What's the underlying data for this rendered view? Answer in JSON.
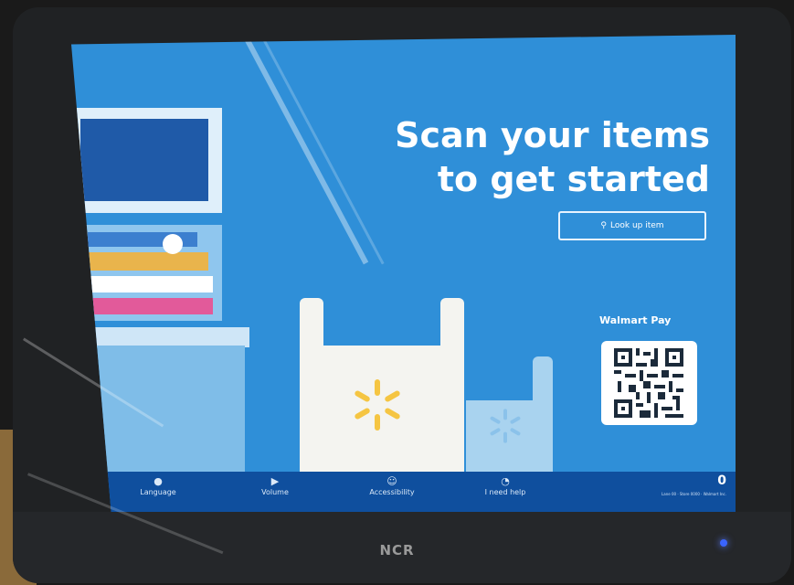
{
  "screen": {
    "headline_line1": "Scan your items",
    "headline_line2": "to get started",
    "lookup_button": "Look up item",
    "pay_label": "Walmart Pay",
    "qr_icon": "qr-code"
  },
  "navbar": {
    "items": [
      {
        "label": "Language",
        "icon": "globe-icon"
      },
      {
        "label": "Volume",
        "icon": "speaker-icon"
      },
      {
        "label": "Accessibility",
        "icon": "accessibility-icon"
      },
      {
        "label": "I need help",
        "icon": "help-icon"
      }
    ],
    "cart_count": "0",
    "fine_print": "Lane 00 · Store 0000 · Walmart Inc."
  },
  "device": {
    "brand": "NCR"
  },
  "colors": {
    "screen_bg": "#2f8fd8",
    "navbar_bg": "#0f4f9e",
    "spark_yellow": "#f5c542"
  }
}
